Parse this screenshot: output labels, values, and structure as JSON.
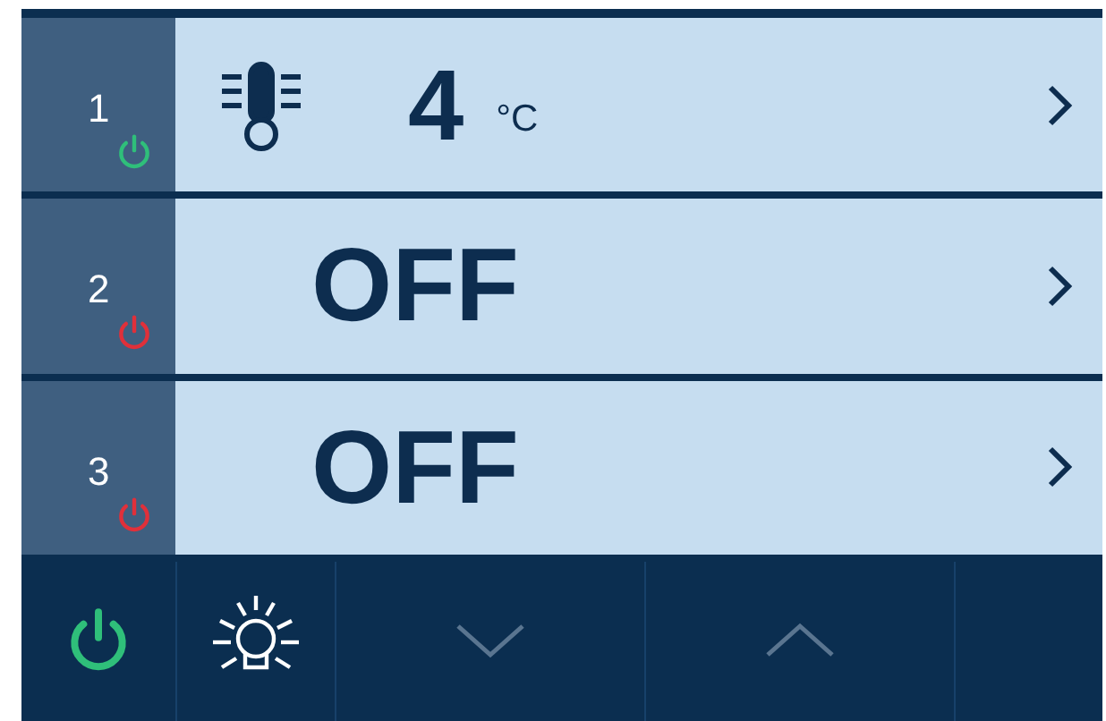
{
  "zones": [
    {
      "number": "1",
      "on": true,
      "kind": "temperature",
      "value": "4",
      "unit": "°C"
    },
    {
      "number": "2",
      "on": false,
      "kind": "off",
      "value": "OFF"
    },
    {
      "number": "3",
      "on": false,
      "kind": "off",
      "value": "OFF"
    }
  ],
  "toolbar": {
    "power_on": true,
    "buttons": [
      {
        "kind": "light",
        "disabled": false
      },
      {
        "kind": "down",
        "disabled": true
      },
      {
        "kind": "up",
        "disabled": true
      }
    ]
  }
}
